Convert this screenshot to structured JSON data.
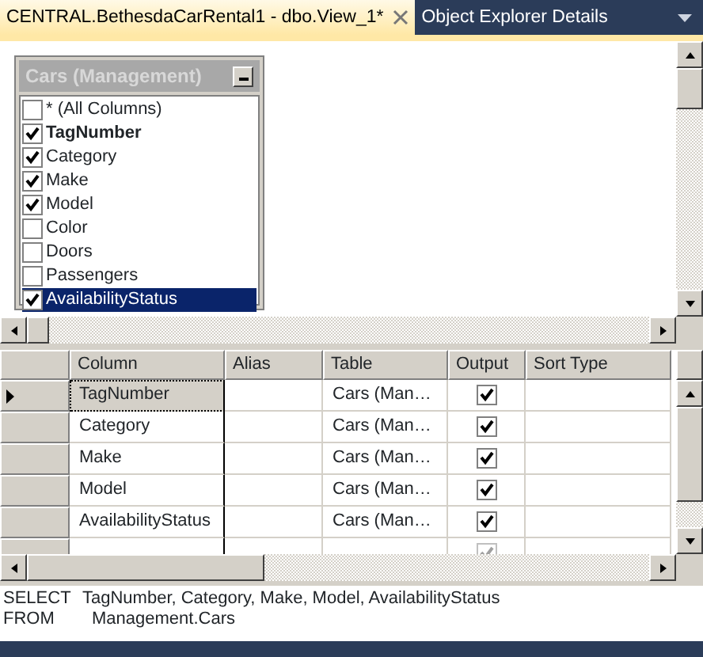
{
  "tabs": [
    {
      "label": "CENTRAL.BethesdaCarRental1 - dbo.View_1*",
      "selected": true,
      "closable": true
    },
    {
      "label": "Object Explorer Details",
      "selected": false,
      "closable": false
    }
  ],
  "diagram": {
    "table": {
      "title": "Cars (Management)",
      "columns": [
        {
          "name": "* (All Columns)",
          "checked": false,
          "primary_key": false,
          "selected": false
        },
        {
          "name": "TagNumber",
          "checked": true,
          "primary_key": true,
          "selected": false
        },
        {
          "name": "Category",
          "checked": true,
          "primary_key": false,
          "selected": false
        },
        {
          "name": "Make",
          "checked": true,
          "primary_key": false,
          "selected": false
        },
        {
          "name": "Model",
          "checked": true,
          "primary_key": false,
          "selected": false
        },
        {
          "name": "Color",
          "checked": false,
          "primary_key": false,
          "selected": false
        },
        {
          "name": "Doors",
          "checked": false,
          "primary_key": false,
          "selected": false
        },
        {
          "name": "Passengers",
          "checked": false,
          "primary_key": false,
          "selected": false
        },
        {
          "name": "AvailabilityStatus",
          "checked": true,
          "primary_key": false,
          "selected": true
        }
      ]
    }
  },
  "criteria": {
    "columns": [
      "Column",
      "Alias",
      "Table",
      "Output",
      "Sort Type"
    ],
    "rows": [
      {
        "column": "TagNumber",
        "alias": "",
        "table": "Cars (Man…",
        "output": true,
        "selected": true,
        "kind": "field"
      },
      {
        "column": "Category",
        "alias": "",
        "table": "Cars (Man…",
        "output": true,
        "selected": false,
        "kind": "field"
      },
      {
        "column": "Make",
        "alias": "",
        "table": "Cars (Man…",
        "output": true,
        "selected": false,
        "kind": "field"
      },
      {
        "column": "Model",
        "alias": "",
        "table": "Cars (Man…",
        "output": true,
        "selected": false,
        "kind": "field"
      },
      {
        "column": "AvailabilityStatus",
        "alias": "",
        "table": "Cars (Man…",
        "output": true,
        "selected": false,
        "kind": "field"
      },
      {
        "column": "",
        "alias": "",
        "table": "",
        "output": true,
        "selected": false,
        "kind": "new"
      }
    ]
  },
  "sql": [
    {
      "keyword": "SELECT",
      "text": "TagNumber, Category, Make, Model, AvailabilityStatus"
    },
    {
      "keyword": "FROM",
      "text": "Management.Cars"
    }
  ]
}
